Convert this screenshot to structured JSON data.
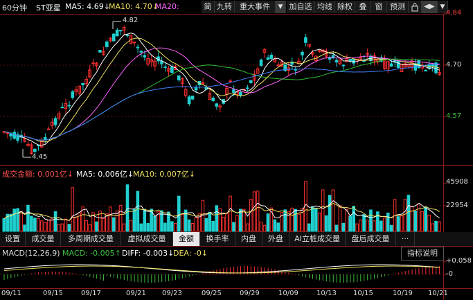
{
  "header": {
    "period": "60分钟",
    "stock_name": "ST亚星",
    "ma5_label": "MA5: 4.69↓",
    "ma10_label": "MA10: 4.70↓",
    "ma20_label": "MA20:",
    "colors": {
      "ma5": "#ffffff",
      "ma10": "#f0e060",
      "ma20": "#ff66ff",
      "up": "#ff3030",
      "down": "#20d0d0"
    }
  },
  "toolbar": {
    "buttons": [
      "简",
      "九转",
      "重大事件",
      "▼",
      "加自选",
      "均线",
      "除权",
      "叠",
      "窗",
      "预测",
      "",
      "◀▶",
      "▼"
    ]
  },
  "price_axis": {
    "labels": [
      "4.84",
      "4.70",
      "4.57"
    ]
  },
  "annotations": {
    "high": "4.82",
    "low": "4.45"
  },
  "volume": {
    "title": "成交金额: 0.001亿↓",
    "ma5_label": "MA5: 0.006亿↓",
    "ma10_label": "MA10: 0.007亿↓",
    "axis_labels": [
      "45908",
      "22954"
    ]
  },
  "tabs": {
    "items": [
      "设置",
      "成交量",
      "多周期成交量",
      "虚拟成交量",
      "金额",
      "换手率",
      "内盘",
      "外盘",
      "AI立桩成交量",
      "盘后成交量",
      "···"
    ],
    "active": "金额",
    "right_button": "指标说明"
  },
  "macd": {
    "title": "MACD(12,26,9)",
    "macd_label": "MACD: -0.005↑",
    "diff_label": "DIFF: -0.003↓",
    "dea_label": "DEA: -0↓",
    "axis_labels": [
      "+0.058",
      "-0"
    ]
  },
  "dates": [
    "09/11",
    "09/15",
    "09/17",
    "09/21",
    "09/23",
    "09/25",
    "09/29",
    "10/09",
    "10/13",
    "10/15",
    "10/19",
    "10/21"
  ]
}
